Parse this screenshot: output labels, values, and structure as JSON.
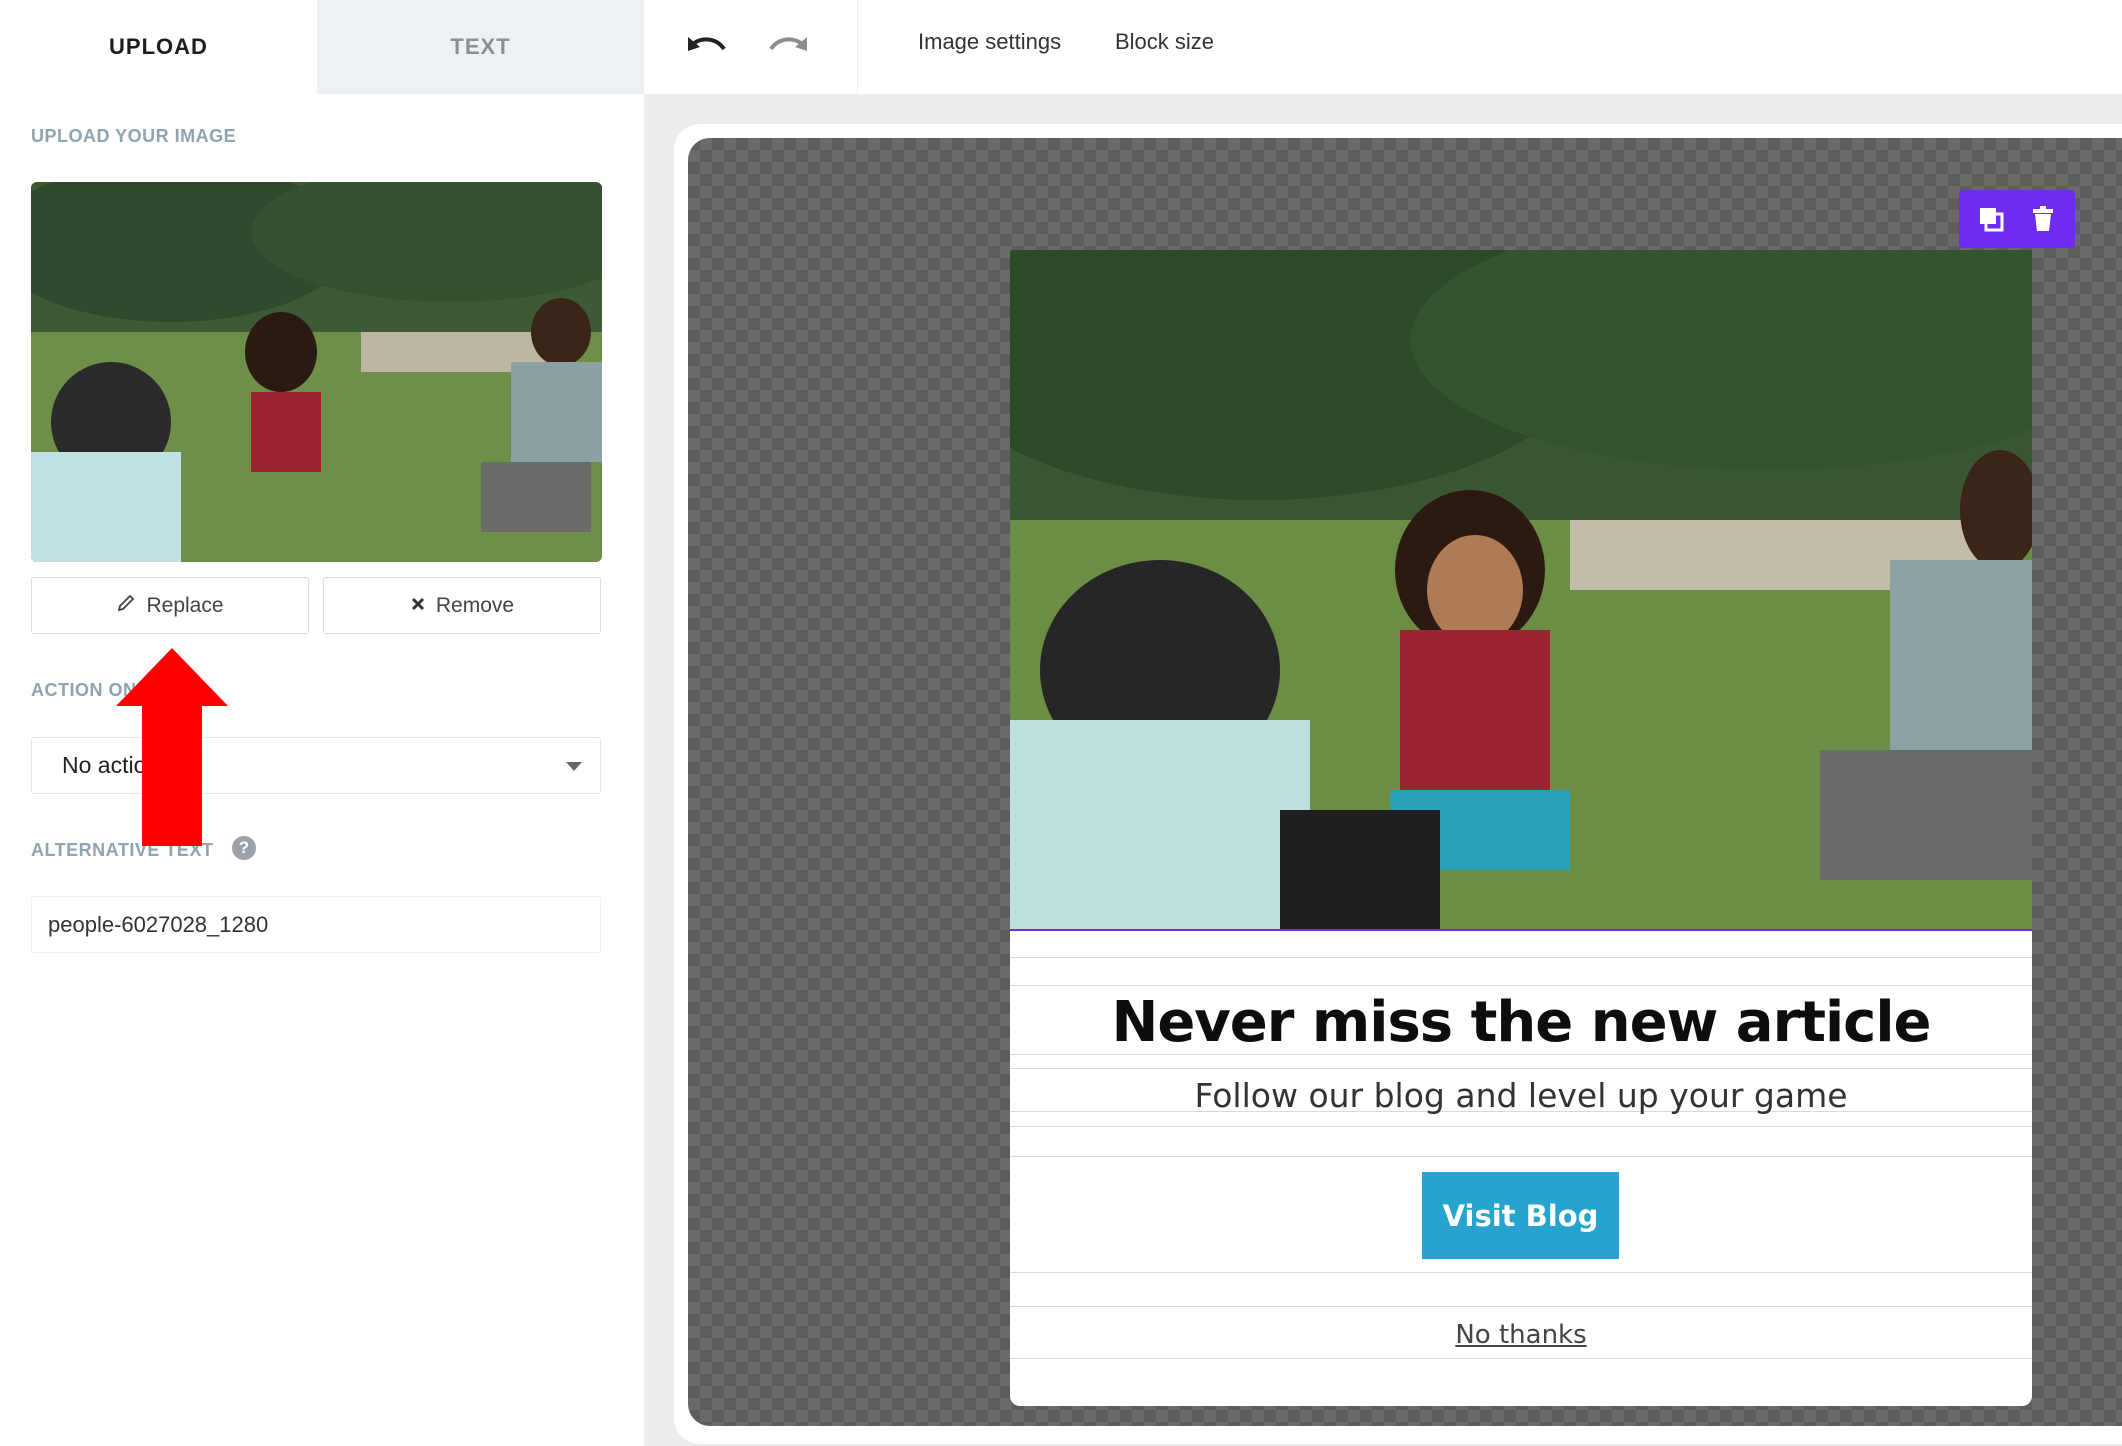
{
  "tabs": [
    {
      "label": "UPLOAD",
      "active": true
    },
    {
      "label": "TEXT",
      "active": false
    }
  ],
  "upload": {
    "section_label": "UPLOAD YOUR IMAGE",
    "replace_label": "Replace",
    "remove_label": "Remove"
  },
  "action": {
    "section_label": "ACTION ON CLICK",
    "selected": "No action"
  },
  "alt_text": {
    "section_label": "ALTERNATIVE TEXT",
    "value": "people-6027028_1280",
    "help_icon": "?"
  },
  "toolbar": {
    "undo_icon": "undo-icon",
    "redo_icon": "redo-icon",
    "image_settings_label": "Image settings",
    "block_size_label": "Block size"
  },
  "popup": {
    "title": "Never miss the new article",
    "subtitle": "Follow our blog and level up your game",
    "cta_label": "Visit Blog",
    "dismiss_label": "No thanks"
  },
  "colors": {
    "accent_purple": "#6f2cf0",
    "cta_blue": "#26a3cf",
    "annotation_red": "#ff0000"
  }
}
